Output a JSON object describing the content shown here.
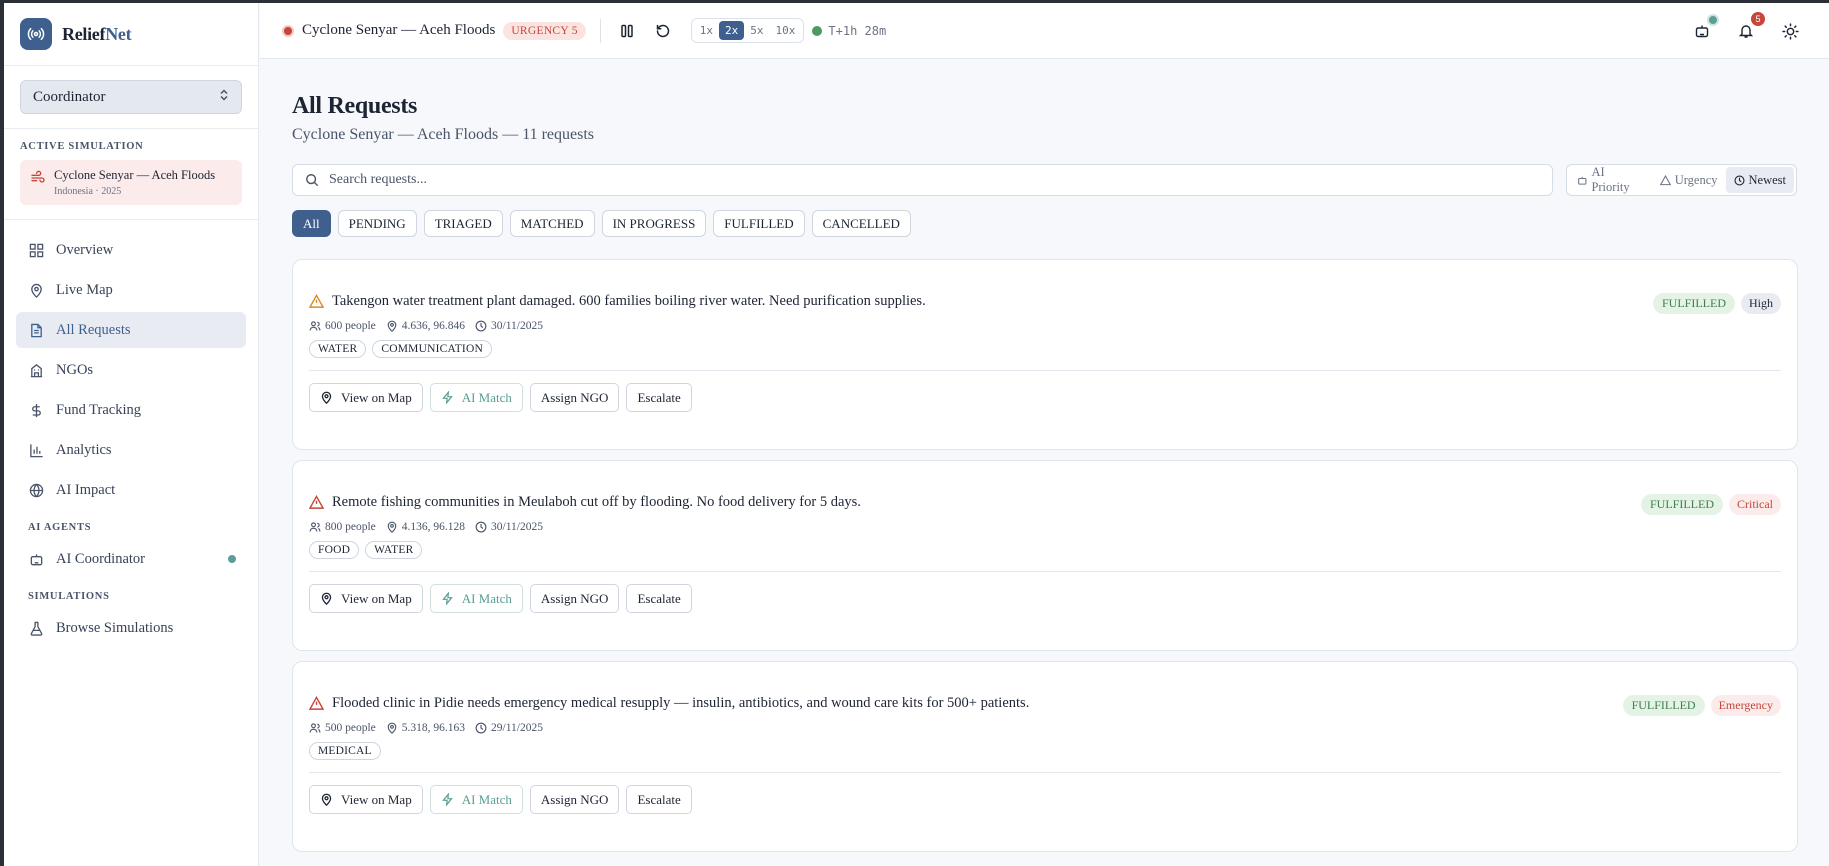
{
  "brand": {
    "name_a": "Relief",
    "name_b": "Net"
  },
  "role": {
    "value": "Coordinator"
  },
  "active_simulation": {
    "label": "ACTIVE SIMULATION",
    "title": "Cyclone Senyar — Aceh Floods",
    "sub": "Indonesia · 2025"
  },
  "nav": {
    "items": [
      {
        "label": "Overview",
        "icon": "grid-icon"
      },
      {
        "label": "Live Map",
        "icon": "map-pin-icon"
      },
      {
        "label": "All Requests",
        "icon": "document-icon",
        "active": true
      },
      {
        "label": "NGOs",
        "icon": "building-icon"
      },
      {
        "label": "Fund Tracking",
        "icon": "dollar-icon"
      },
      {
        "label": "Analytics",
        "icon": "bar-chart-icon"
      },
      {
        "label": "AI Impact",
        "icon": "globe-icon"
      }
    ],
    "ai_section": "AI AGENTS",
    "ai_coordinator": "AI Coordinator",
    "sim_section": "SIMULATIONS",
    "browse": "Browse Simulations"
  },
  "topbar": {
    "sim_title": "Cyclone Senyar — Aceh Floods",
    "urgency": "URGENCY 5",
    "speeds": [
      "1x",
      "2x",
      "5x",
      "10x"
    ],
    "active_speed": "2x",
    "clock": "T+1h 28m",
    "notifications": "5"
  },
  "page": {
    "title": "All Requests",
    "subtitle": "Cyclone Senyar — Aceh Floods — 11 requests",
    "search_placeholder": "Search requests...",
    "sort": {
      "ai_priority": "AI Priority",
      "urgency": "Urgency",
      "newest": "Newest"
    },
    "filters": [
      "All",
      "PENDING",
      "TRIAGED",
      "MATCHED",
      "IN PROGRESS",
      "FULFILLED",
      "CANCELLED"
    ]
  },
  "actions": {
    "view_map": "View on Map",
    "ai_match": "AI Match",
    "assign": "Assign NGO",
    "escalate": "Escalate"
  },
  "requests": [
    {
      "title": "Takengon water treatment plant damaged. 600 families boiling river water. Need purification supplies.",
      "people": "600 people",
      "coords": "4.636, 96.846",
      "date": "30/11/2025",
      "tags": [
        "WATER",
        "COMMUNICATION"
      ],
      "status": "FULFILLED",
      "priority": "High",
      "warn_color": "#d98a2b"
    },
    {
      "title": "Remote fishing communities in Meulaboh cut off by flooding. No food delivery for 5 days.",
      "people": "800 people",
      "coords": "4.136, 96.128",
      "date": "30/11/2025",
      "tags": [
        "FOOD",
        "WATER"
      ],
      "status": "FULFILLED",
      "priority": "Critical",
      "warn_color": "#c6463a"
    },
    {
      "title": "Flooded clinic in Pidie needs emergency medical resupply — insulin, antibiotics, and wound care kits for 500+ patients.",
      "people": "500 people",
      "coords": "5.318, 96.163",
      "date": "29/11/2025",
      "tags": [
        "MEDICAL"
      ],
      "status": "FULFILLED",
      "priority": "Emergency",
      "warn_color": "#c6463a"
    }
  ]
}
